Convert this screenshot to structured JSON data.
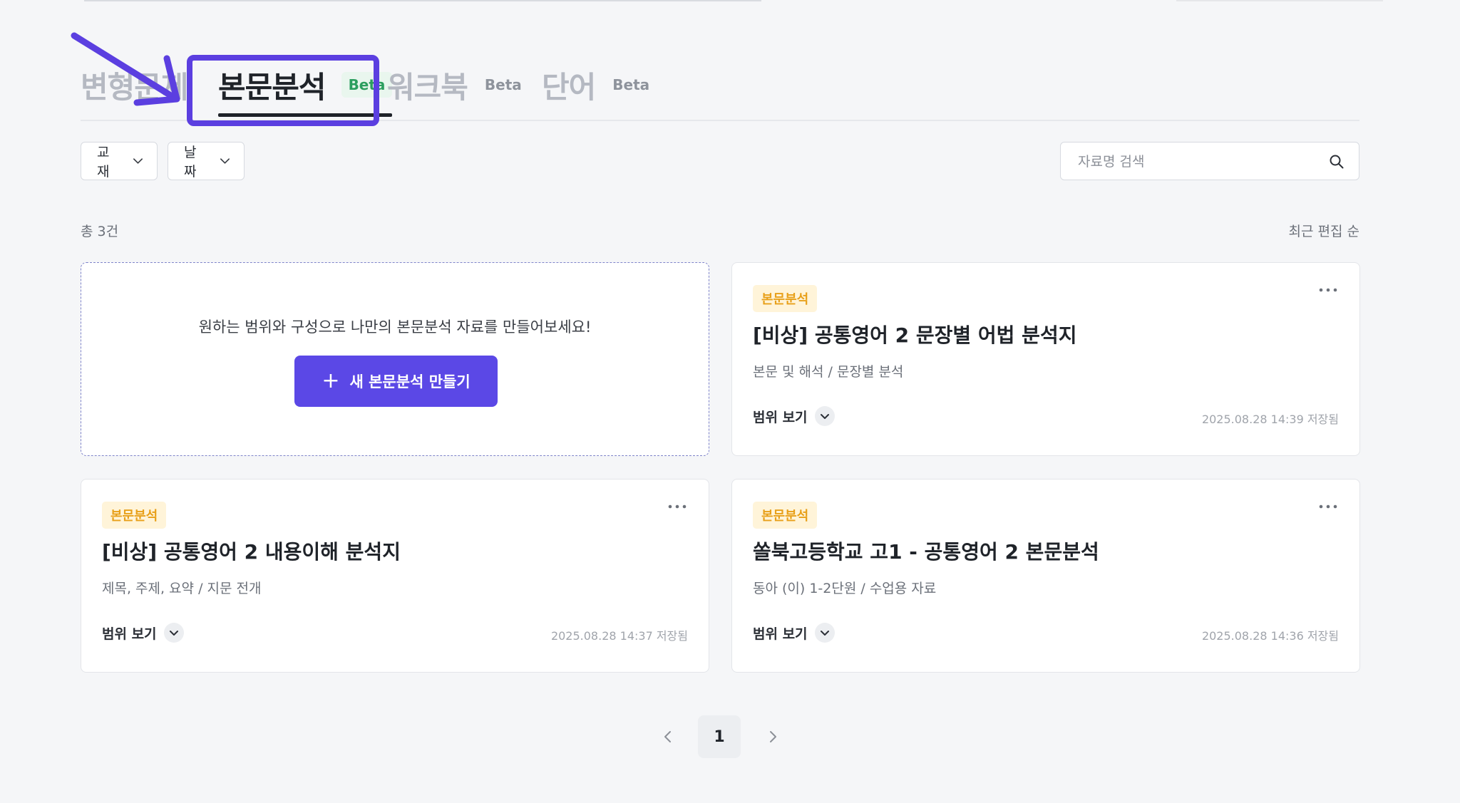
{
  "tabs": [
    {
      "label": "변형문제",
      "badge": ""
    },
    {
      "label": "본문분석",
      "badge": "Beta"
    },
    {
      "label": "워크북",
      "badge": "Beta"
    },
    {
      "label": "단어",
      "badge": "Beta"
    }
  ],
  "filters": {
    "textbook_label": "교재",
    "date_label": "날짜"
  },
  "search": {
    "placeholder": "자료명 검색"
  },
  "list": {
    "count_text": "총 3건",
    "sort_text": "최근 편집 순"
  },
  "create_card": {
    "prompt": "원하는 범위와 구성으로 나만의 본문분석 자료를 만들어보세요!",
    "button_label": "새 본문분석 만들기"
  },
  "cards": [
    {
      "tag": "본문분석",
      "title": "[비상] 공통영어 2 문장별 어법 분석지",
      "subtitle": "본문 및 해석 / 문장별 분석",
      "range_label": "범위 보기",
      "saved": "2025.08.28 14:39 저장됨"
    },
    {
      "tag": "본문분석",
      "title": "[비상] 공통영어 2 내용이해 분석지",
      "subtitle": "제목, 주제, 요약 / 지문 전개",
      "range_label": "범위 보기",
      "saved": "2025.08.28 14:37 저장됨"
    },
    {
      "tag": "본문분석",
      "title": "쏠북고등학교 고1 - 공통영어 2 본문분석",
      "subtitle": "동아 (이) 1-2단원 / 수업용 자료",
      "range_label": "범위 보기",
      "saved": "2025.08.28 14:36 저장됨"
    }
  ],
  "pagination": {
    "current_page": "1"
  },
  "colors": {
    "accent": "#5b48e6",
    "highlight": "#5b3fe0",
    "tag_bg": "#fff4d9",
    "tag_text": "#e8a01a",
    "beta_active": "#2c9e5f"
  }
}
